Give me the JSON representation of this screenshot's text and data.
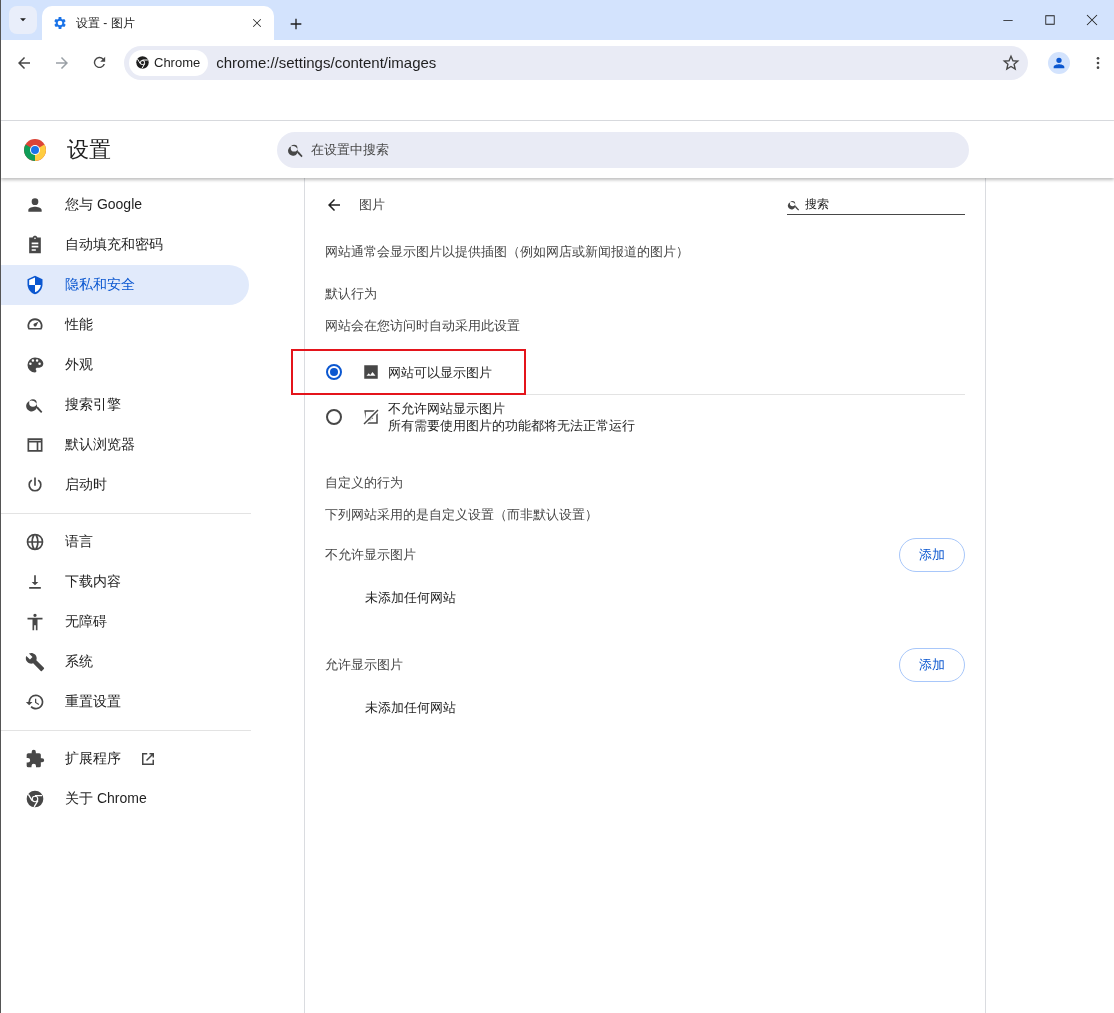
{
  "window": {
    "tab_title": "设置 - 图片",
    "address_chip": "Chrome",
    "url": "chrome://settings/content/images"
  },
  "header": {
    "title": "设置",
    "search": {
      "placeholder": "在设置中搜索"
    }
  },
  "sidebar": {
    "groups": [
      [
        {
          "label": "您与 Google",
          "selected": false,
          "external": false
        },
        {
          "label": "自动填充和密码",
          "selected": false,
          "external": false
        },
        {
          "label": "隐私和安全",
          "selected": true,
          "external": false
        },
        {
          "label": "性能",
          "selected": false,
          "external": false
        },
        {
          "label": "外观",
          "selected": false,
          "external": false
        },
        {
          "label": "搜索引擎",
          "selected": false,
          "external": false
        },
        {
          "label": "默认浏览器",
          "selected": false,
          "external": false
        },
        {
          "label": "启动时",
          "selected": false,
          "external": false
        }
      ],
      [
        {
          "label": "语言",
          "selected": false,
          "external": false
        },
        {
          "label": "下载内容",
          "selected": false,
          "external": false
        },
        {
          "label": "无障碍",
          "selected": false,
          "external": false
        },
        {
          "label": "系统",
          "selected": false,
          "external": false
        },
        {
          "label": "重置设置",
          "selected": false,
          "external": false
        }
      ],
      [
        {
          "label": "扩展程序",
          "selected": false,
          "external": true
        },
        {
          "label": "关于 Chrome",
          "selected": false,
          "external": false
        }
      ]
    ]
  },
  "page": {
    "title": "图片",
    "search": {
      "placeholder": "搜索"
    },
    "description": "网站通常会显示图片以提供插图（例如网店或新闻报道的图片）",
    "default_heading": "默认行为",
    "default_hint": "网站会在您访问时自动采用此设置",
    "options": [
      {
        "label": "网站可以显示图片",
        "selected": true,
        "highlighted": true
      },
      {
        "label": "不允许网站显示图片",
        "subtitle": "所有需要使用图片的功能都将无法正常运行",
        "selected": false,
        "highlighted": false
      }
    ],
    "custom_heading": "自定义的行为",
    "custom_hint": "下列网站采用的是自定义设置（而非默认设置）",
    "lists": [
      {
        "title": "不允许显示图片",
        "button": "添加",
        "empty": "未添加任何网站"
      },
      {
        "title": "允许显示图片",
        "button": "添加",
        "empty": "未添加任何网站"
      }
    ]
  }
}
